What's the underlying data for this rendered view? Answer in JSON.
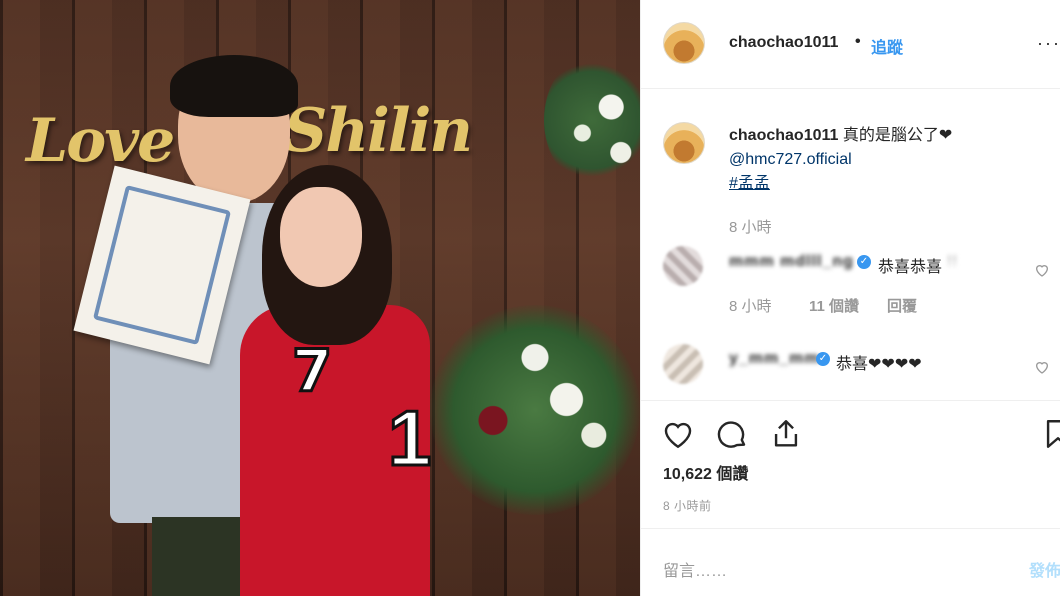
{
  "photo": {
    "sign_word_1": "Love",
    "sign_word_2": "Shilin",
    "jersey_number_front": "7",
    "jersey_number_sleeve": "1"
  },
  "header": {
    "username": "chaochao1011",
    "separator": "•",
    "follow_label": "追蹤",
    "more_label": "···"
  },
  "caption": {
    "username": "chaochao1011",
    "text": "真的是腦公了❤",
    "mention": "@hmc727.official",
    "hashtag": "#孟孟",
    "time": "8 小時"
  },
  "comments": [
    {
      "username_blurred": "mmm mdlll_ng",
      "text": "恭喜恭喜",
      "trailing_blurred": "!!",
      "time": "8 小時",
      "likes": "11 個讚",
      "reply_label": "回覆"
    },
    {
      "username_blurred": "y_mm_mm",
      "text": "恭喜❤❤❤❤"
    }
  ],
  "stats": {
    "views": "10,622 個讚",
    "time_ago": "8 小時前"
  },
  "composer": {
    "placeholder": "留言……",
    "post_label": "發佈"
  },
  "colors": {
    "link": "#3897f0",
    "mention": "#003569",
    "muted": "#999999",
    "post_disabled": "#b2dffc"
  }
}
